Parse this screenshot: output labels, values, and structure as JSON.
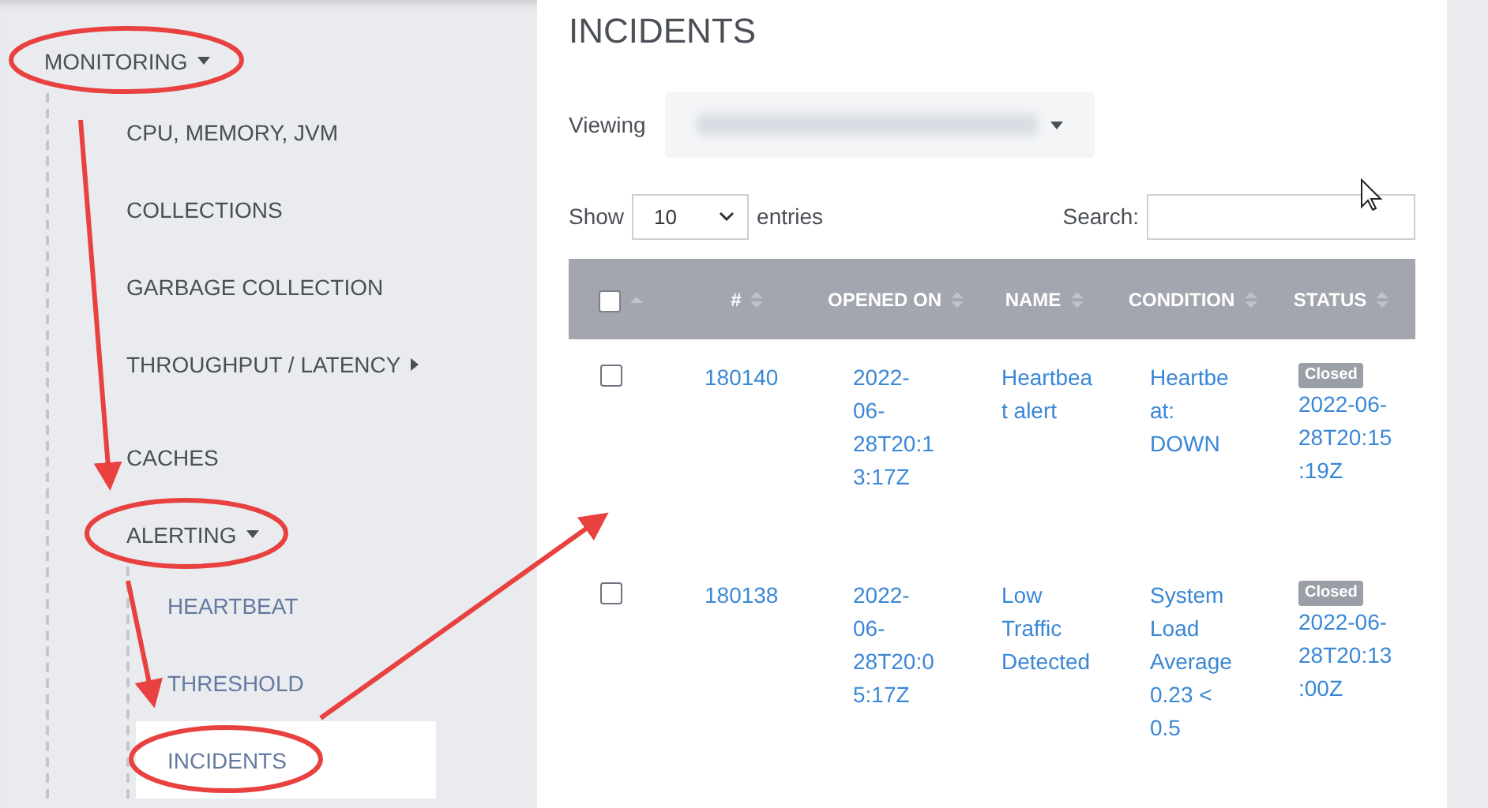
{
  "sidebar": {
    "items": [
      {
        "label": "MONITORING",
        "expanded": true,
        "selected": false,
        "children": [
          {
            "label": "CPU, MEMORY, JVM",
            "selected": false
          },
          {
            "label": "COLLECTIONS",
            "selected": false
          },
          {
            "label": "GARBAGE COLLECTION",
            "selected": false
          },
          {
            "label": "THROUGHPUT / LATENCY",
            "expanded": false,
            "selected": false
          },
          {
            "label": "CACHES",
            "selected": false
          },
          {
            "label": "ALERTING",
            "expanded": true,
            "selected": false,
            "children": [
              {
                "label": "HEARTBEAT",
                "selected": false
              },
              {
                "label": "THRESHOLD",
                "selected": false
              },
              {
                "label": "INCIDENTS",
                "selected": true
              }
            ]
          }
        ]
      }
    ]
  },
  "page": {
    "title": "INCIDENTS",
    "viewing_label": "Viewing"
  },
  "table_controls": {
    "show_label": "Show",
    "page_size": "10",
    "entries_label": "entries",
    "search_label": "Search:"
  },
  "table": {
    "header_checked": false,
    "columns": [
      "#",
      "OPENED ON",
      "NAME",
      "CONDITION",
      "STATUS"
    ],
    "rows": [
      {
        "checked": false,
        "id": "180140",
        "opened_on": "2022-06-28T20:13:17Z",
        "name": "Heartbeat alert",
        "condition": "Heartbeat: DOWN",
        "status": "Closed",
        "status_time": "2022-06-28T20:15:19Z"
      },
      {
        "checked": false,
        "id": "180138",
        "opened_on": "2022-06-28T20:05:17Z",
        "name": "Low Traffic Detected",
        "condition": "System Load Average 0.23 < 0.5",
        "status": "Closed",
        "status_time": "2022-06-28T20:13:00Z"
      }
    ]
  }
}
